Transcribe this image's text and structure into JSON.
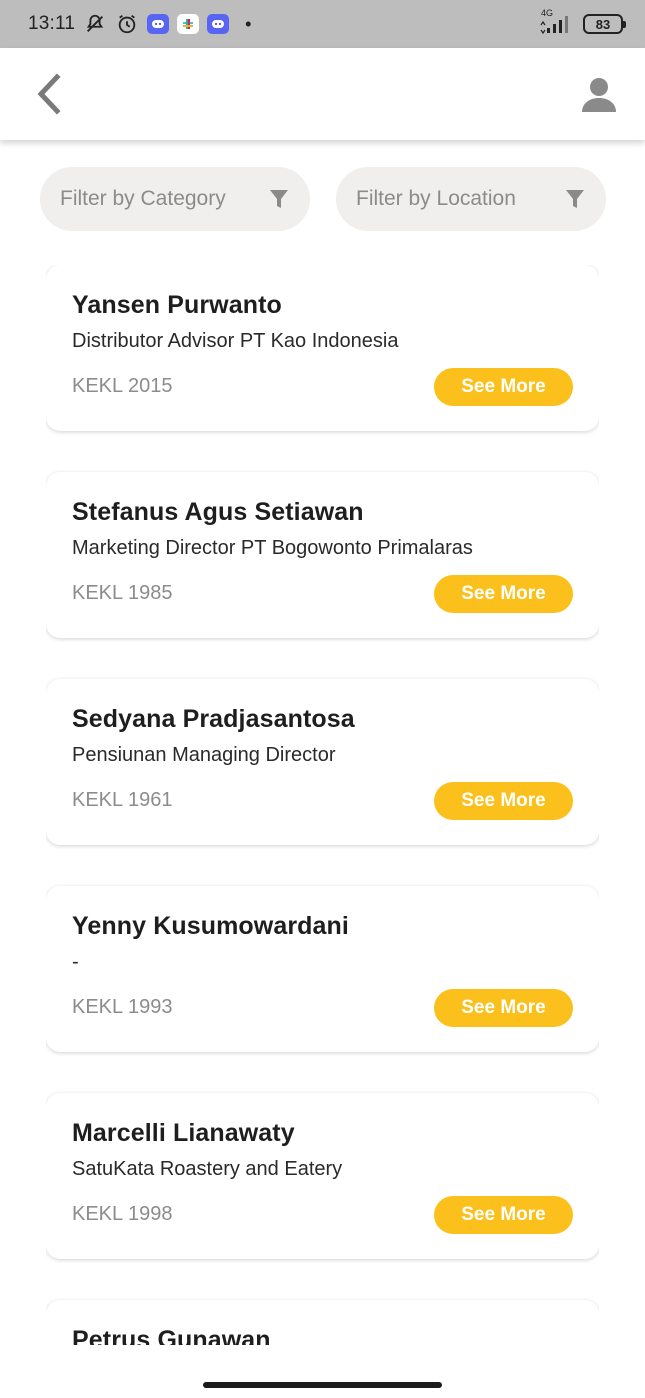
{
  "status_bar": {
    "time": "13:11",
    "network": "4G",
    "battery": "83"
  },
  "app_bar": {
    "back_icon": "chevron-left-icon",
    "profile_icon": "person-icon"
  },
  "filters": {
    "category_label": "Filter by Category",
    "location_label": "Filter by Location",
    "icon": "funnel-icon"
  },
  "cards": [
    {
      "name": "Yansen Purwanto",
      "title": "Distributor Advisor PT Kao Indonesia",
      "year": "KEKL 2015",
      "button": "See More"
    },
    {
      "name": "Stefanus Agus Setiawan",
      "title": "Marketing Director PT Bogowonto Primalaras",
      "year": "KEKL 1985",
      "button": "See More"
    },
    {
      "name": "Sedyana Pradjasantosa",
      "title": "Pensiunan Managing Director",
      "year": "KEKL 1961",
      "button": "See More"
    },
    {
      "name": "Yenny Kusumowardani",
      "title": "-",
      "year": "KEKL 1993",
      "button": "See More"
    },
    {
      "name": "Marcelli Lianawaty",
      "title": "SatuKata Roastery and Eatery",
      "year": "KEKL 1998",
      "button": "See More"
    },
    {
      "name": "Petrus Gunawan",
      "title": "",
      "year": "",
      "button": ""
    }
  ],
  "colors": {
    "accent": "#fbc01b",
    "status_bar": "#bdbdbd",
    "filter_bg": "#f1efed"
  }
}
